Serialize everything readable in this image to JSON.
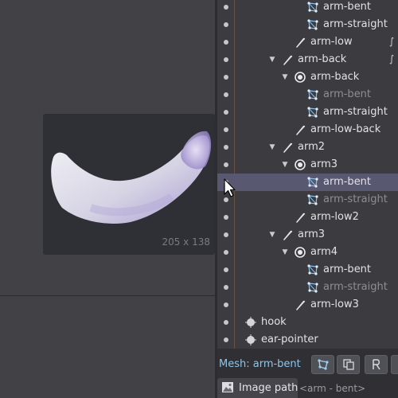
{
  "preview": {
    "size_label": "205 x 138"
  },
  "tree": {
    "rows": [
      {
        "label": "arm-bent",
        "kind": "mesh",
        "depth": 4,
        "dim": false
      },
      {
        "label": "arm-straight",
        "kind": "mesh",
        "depth": 4,
        "dim": false
      },
      {
        "label": "arm-low",
        "kind": "bone",
        "depth": 3,
        "dim": false
      },
      {
        "label": "arm-back",
        "kind": "bone",
        "depth": 2,
        "dim": false
      },
      {
        "label": "arm-back",
        "kind": "slot",
        "depth": 3,
        "dim": false
      },
      {
        "label": "arm-bent",
        "kind": "mesh",
        "depth": 4,
        "dim": true
      },
      {
        "label": "arm-straight",
        "kind": "mesh",
        "depth": 4,
        "dim": false
      },
      {
        "label": "arm-low-back",
        "kind": "bone",
        "depth": 3,
        "dim": false
      },
      {
        "label": "arm2",
        "kind": "bone",
        "depth": 2,
        "dim": false
      },
      {
        "label": "arm3",
        "kind": "slot",
        "depth": 3,
        "dim": false
      },
      {
        "label": "arm-bent",
        "kind": "mesh",
        "depth": 4,
        "dim": false
      },
      {
        "label": "arm-straight",
        "kind": "mesh",
        "depth": 4,
        "dim": true
      },
      {
        "label": "arm-low2",
        "kind": "bone",
        "depth": 3,
        "dim": false
      },
      {
        "label": "arm3",
        "kind": "bone",
        "depth": 2,
        "dim": false
      },
      {
        "label": "arm4",
        "kind": "slot",
        "depth": 3,
        "dim": false
      },
      {
        "label": "arm-bent",
        "kind": "mesh",
        "depth": 4,
        "dim": false
      },
      {
        "label": "arm-straight",
        "kind": "mesh",
        "depth": 4,
        "dim": true
      },
      {
        "label": "arm-low3",
        "kind": "bone",
        "depth": 3,
        "dim": false
      },
      {
        "label": "hook",
        "kind": "point",
        "depth": 1,
        "dim": false
      },
      {
        "label": "ear-pointer",
        "kind": "point",
        "depth": 1,
        "dim": false
      }
    ]
  },
  "bottom": {
    "mesh_label": "Mesh: arm-bent",
    "tab_label": "Image path",
    "path_value": "<arm - bent>"
  },
  "colors": {
    "selection": "#585870",
    "mesh_label": "#8fc4e8",
    "guide": "#7a5a44"
  }
}
